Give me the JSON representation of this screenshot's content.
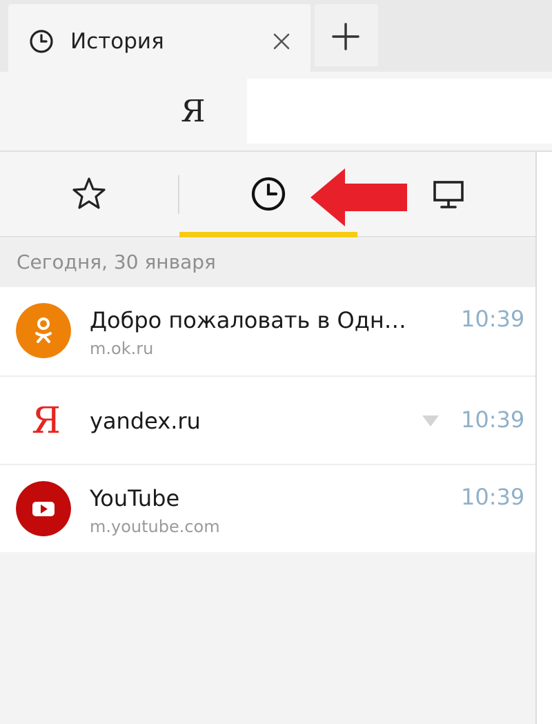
{
  "tab": {
    "title": "История",
    "icon": "clock-icon"
  },
  "omnibox": {
    "logo": "Я"
  },
  "history": {
    "date_header": "Сегодня, 30 января",
    "items": [
      {
        "title": "Добро пожаловать в Одн…",
        "url": "m.ok.ru",
        "time": "10:39",
        "icon": "odnoklassniki-icon"
      },
      {
        "title": "yandex.ru",
        "url": "",
        "time": "10:39",
        "icon_text": "Я",
        "icon": "yandex-icon"
      },
      {
        "title": "YouTube",
        "url": "m.youtube.com",
        "time": "10:39",
        "icon": "youtube-icon"
      }
    ]
  },
  "colors": {
    "accent_underline": "#f7cb12",
    "arrow": "#e8202a",
    "time": "#90b0c8",
    "ok": "#ee8209",
    "youtube": "#c20a0a",
    "yandex": "#e52620"
  }
}
